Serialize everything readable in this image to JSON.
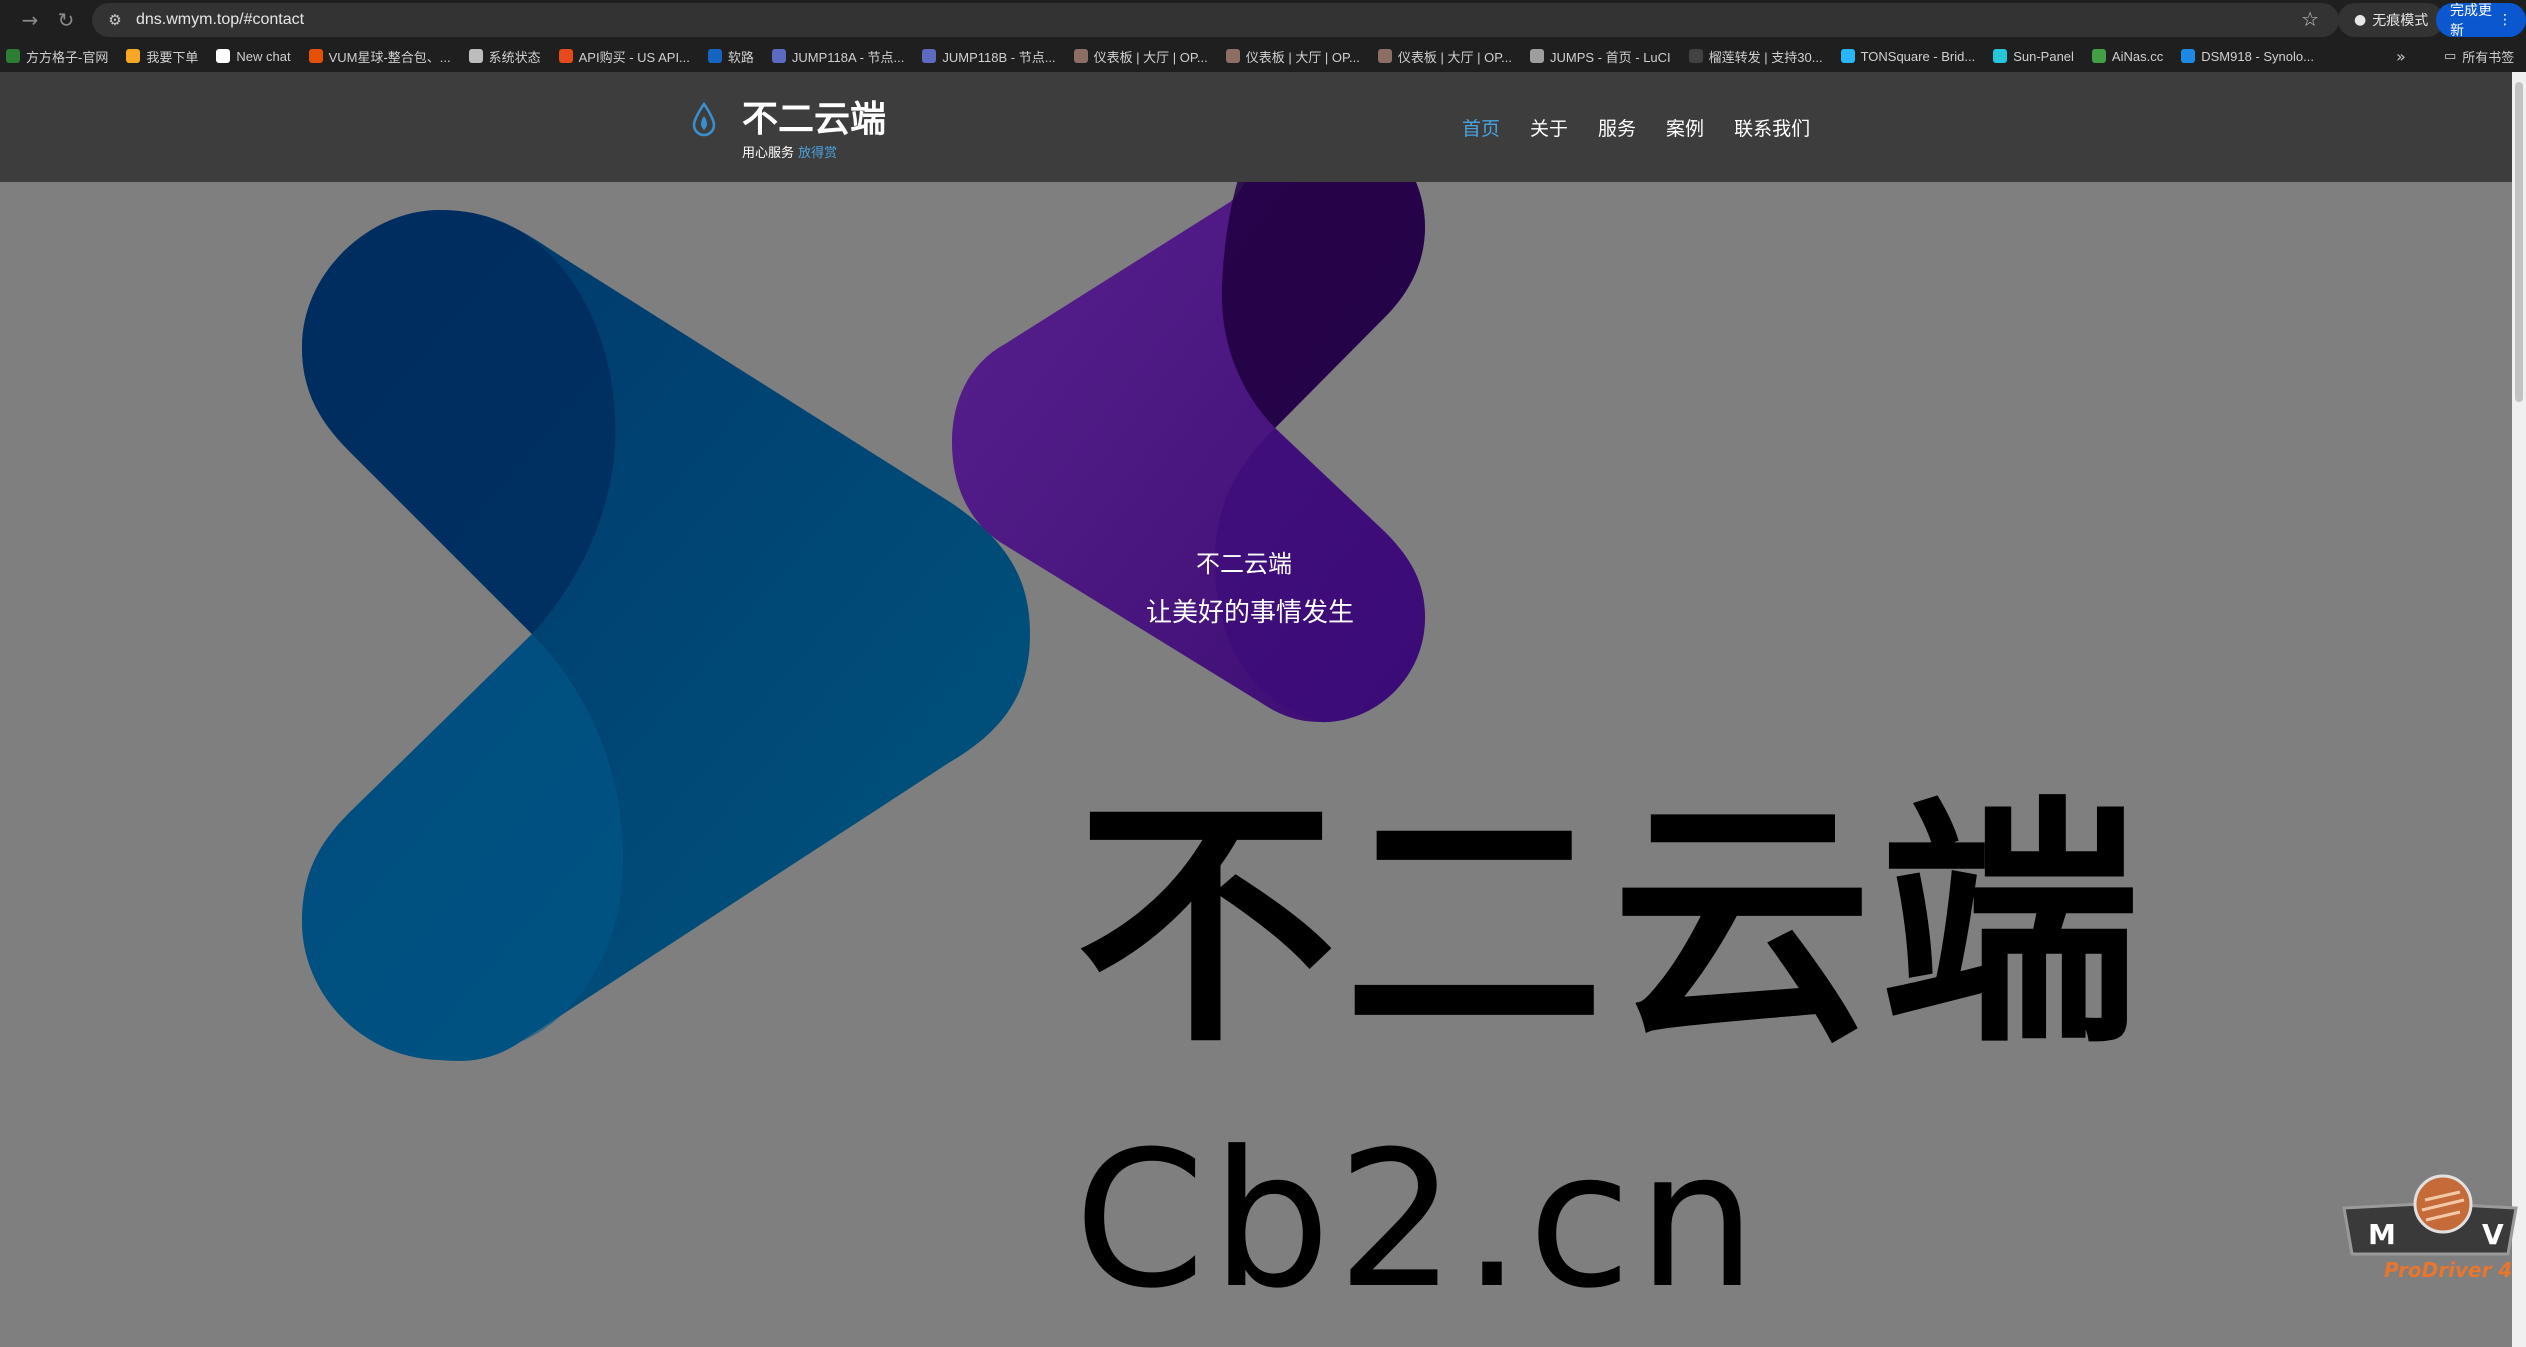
{
  "browser": {
    "url": "dns.wmym.top/#contact",
    "incognito_label": "无痕模式",
    "update_label": "完成更新",
    "bookmarks": [
      {
        "label": "方方格子-官网",
        "color": "#2e7d32"
      },
      {
        "label": "我要下单",
        "color": "#f9a825"
      },
      {
        "label": "New chat",
        "color": "#ffffff"
      },
      {
        "label": "VUM星球-整合包、...",
        "color": "#e65100"
      },
      {
        "label": "系统状态",
        "color": "#bdbdbd"
      },
      {
        "label": "API购买 - US API...",
        "color": "#e64a19"
      },
      {
        "label": "软路",
        "color": "#1565c0"
      },
      {
        "label": "JUMP118A - 节点...",
        "color": "#5c6bc0"
      },
      {
        "label": "JUMP118B - 节点...",
        "color": "#5c6bc0"
      },
      {
        "label": "仪表板 | 大厅 | OP...",
        "color": "#8d6e63"
      },
      {
        "label": "仪表板 | 大厅 | OP...",
        "color": "#8d6e63"
      },
      {
        "label": "仪表板 | 大厅 | OP...",
        "color": "#8d6e63"
      },
      {
        "label": "JUMPS - 首页 - LuCI",
        "color": "#9e9e9e"
      },
      {
        "label": "榴莲转发 | 支持30...",
        "color": "#424242"
      },
      {
        "label": "TONSquare - Brid...",
        "color": "#29b6f6"
      },
      {
        "label": "Sun-Panel",
        "color": "#26c6da"
      },
      {
        "label": "AiNas.cc",
        "color": "#43a047"
      },
      {
        "label": "DSM918 - Synolo...",
        "color": "#1e88e5"
      }
    ],
    "all_bookmarks_label": "所有书签"
  },
  "site": {
    "brand": "不二云端",
    "tagline": "用心服务",
    "tagline_accent": "放得赏",
    "nav": [
      {
        "label": "首页",
        "active": true
      },
      {
        "label": "关于",
        "active": false
      },
      {
        "label": "服务",
        "active": false
      },
      {
        "label": "案例",
        "active": false
      },
      {
        "label": "联系我们",
        "active": false
      }
    ],
    "hero_title": "不二云端",
    "hero_slogan": "让美好的事情发生",
    "big_name": "不二云端",
    "big_domain": "Cb2.cn"
  },
  "badge": {
    "left": "M",
    "right": "V",
    "text": "ProDriver 4"
  },
  "colors": {
    "accent": "#4aa3df",
    "header_bg": "#3d3d3d",
    "hero_bg": "#7f7f7f",
    "blue_shape": "#004a7c",
    "purple_shape": "#4b157a"
  }
}
